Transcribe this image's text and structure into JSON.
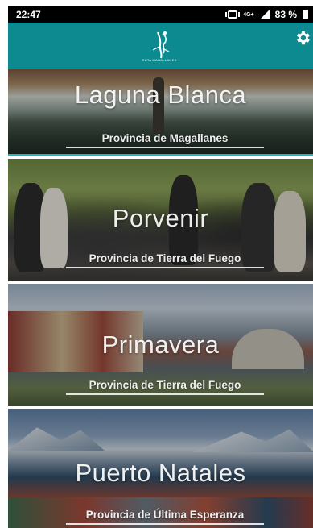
{
  "statusbar": {
    "time": "22:47",
    "network": "4G+",
    "battery": "83 %"
  },
  "header": {
    "logo_text": "RUTA MAGALLANES",
    "settings_icon": "gear-icon",
    "color": "#0d8a8f"
  },
  "destinations": [
    {
      "title": "Laguna Blanca",
      "province": "Provincia de Magallanes"
    },
    {
      "title": "Porvenir",
      "province": "Provincia de Tierra del Fuego"
    },
    {
      "title": "Primavera",
      "province": "Provincia de Tierra del Fuego"
    },
    {
      "title": "Puerto Natales",
      "province": "Provincia de Última Esperanza"
    }
  ]
}
